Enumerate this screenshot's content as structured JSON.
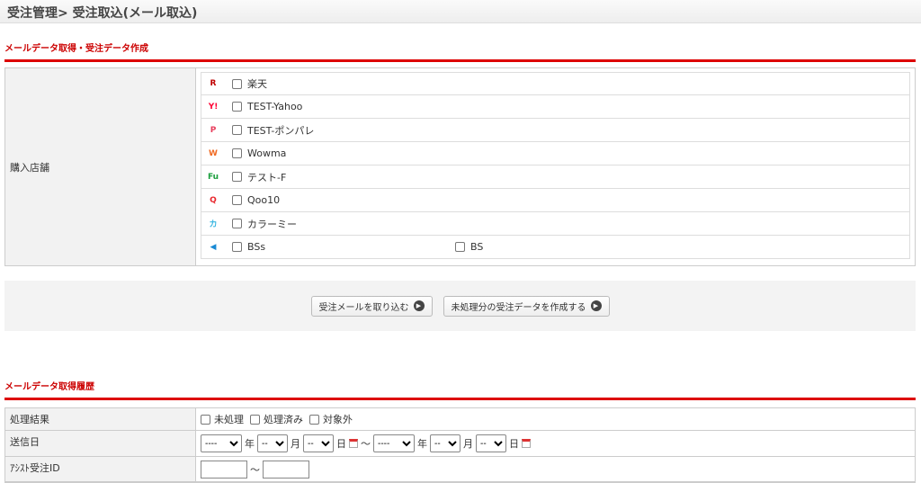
{
  "header": {
    "title": "受注管理> 受注取込(メール取込)"
  },
  "section1": {
    "title": "メールデータ取得・受注データ作成",
    "label": "購入店舗",
    "shops": [
      {
        "icon": "rakuten-icon",
        "glyph": "R",
        "color": "#bf0000",
        "label": "楽天"
      },
      {
        "icon": "yahoo-icon",
        "glyph": "Y!",
        "color": "#ff0033",
        "label": "TEST-Yahoo"
      },
      {
        "icon": "ponpare-icon",
        "glyph": "P",
        "color": "#e83e5c",
        "label": "TEST-ポンパレ"
      },
      {
        "icon": "wowma-icon",
        "glyph": "W",
        "color": "#f06a22",
        "label": "Wowma"
      },
      {
        "icon": "fu-icon",
        "glyph": "Fu",
        "color": "#1a9e3c",
        "label": "テスト-F"
      },
      {
        "icon": "qoo10-icon",
        "glyph": "Q",
        "color": "#e8262c",
        "label": "Qoo10"
      },
      {
        "icon": "colorme-icon",
        "glyph": "カ",
        "color": "#3ab6e0",
        "label": "カラーミー"
      },
      {
        "icon": "bs-icon",
        "glyph": "◀",
        "color": "#1a8ad4",
        "label": "BSs",
        "label2": "BS"
      }
    ]
  },
  "buttons": {
    "import": "受注メールを取り込む",
    "create": "未処理分の受注データを作成する"
  },
  "section2": {
    "title": "メールデータ取得履歴",
    "result_label": "処理結果",
    "result_options": [
      "未処理",
      "処理済み",
      "対象外"
    ],
    "date_label": "送信日",
    "year_placeholder": "----",
    "md_placeholder": "--",
    "year": "年",
    "month": "月",
    "day": "日",
    "tilde": "～",
    "id_label": "ｱｼｽﾄ受注ID",
    "id_tilde": "～"
  }
}
